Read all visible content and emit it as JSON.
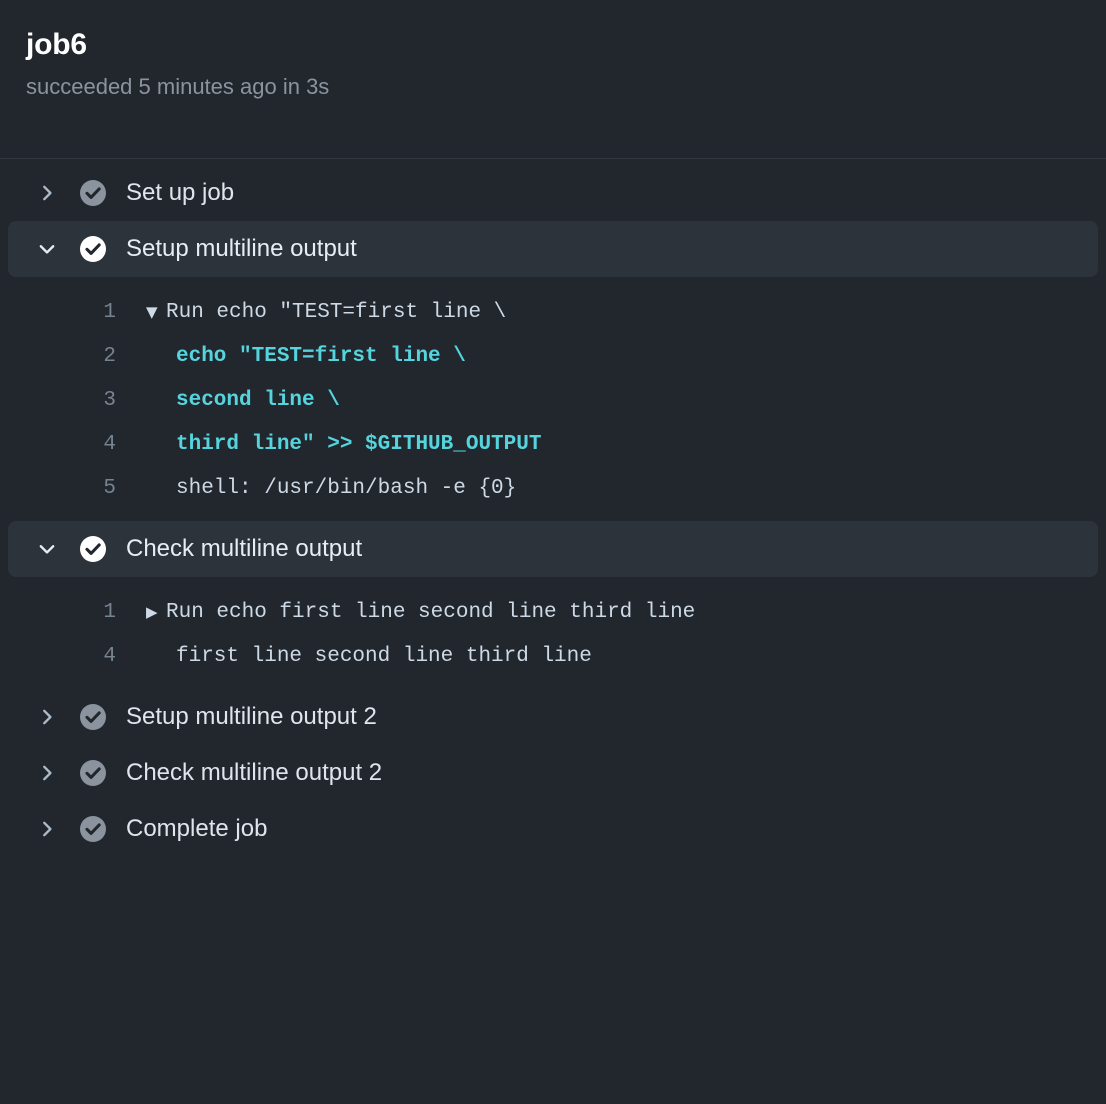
{
  "header": {
    "title": "job6",
    "status_line": "succeeded 5 minutes ago in 3s"
  },
  "colors": {
    "background": "#22272e",
    "row_highlight": "#2d333b",
    "accent_cyan": "#56d4dd",
    "text_primary": "#e6edf3",
    "text_muted": "#8b949e",
    "check_success": "#ffffff",
    "check_collapsed": "#8b939e"
  },
  "steps": [
    {
      "title": "Set up job",
      "state": "collapsed",
      "status": "success",
      "chevron_icon": "chevron-right-icon",
      "status_icon": "check-circle-icon",
      "log": []
    },
    {
      "title": "Setup multiline output",
      "state": "expanded",
      "status": "success",
      "chevron_icon": "chevron-down-icon",
      "status_icon": "check-circle-icon",
      "log": [
        {
          "num": "1",
          "marker": "▼",
          "indent": false,
          "text": "Run echo \"TEST=first line \\",
          "style": "plain"
        },
        {
          "num": "2",
          "marker": "",
          "indent": true,
          "text": "echo \"TEST=first line \\",
          "style": "cyan"
        },
        {
          "num": "3",
          "marker": "",
          "indent": true,
          "text": "second line \\",
          "style": "cyan"
        },
        {
          "num": "4",
          "marker": "",
          "indent": true,
          "text": "third line\" >> $GITHUB_OUTPUT",
          "style": "cyan"
        },
        {
          "num": "5",
          "marker": "",
          "indent": true,
          "text": "shell: /usr/bin/bash -e {0}",
          "style": "plain"
        }
      ]
    },
    {
      "title": "Check multiline output",
      "state": "expanded",
      "status": "success",
      "chevron_icon": "chevron-down-icon",
      "status_icon": "check-circle-icon",
      "log": [
        {
          "num": "1",
          "marker": "▶",
          "indent": false,
          "text": "Run echo first line second line third line",
          "style": "plain"
        },
        {
          "num": "4",
          "marker": "",
          "indent": true,
          "text": "first line second line third line",
          "style": "plain"
        }
      ]
    },
    {
      "title": "Setup multiline output 2",
      "state": "collapsed",
      "status": "success",
      "chevron_icon": "chevron-right-icon",
      "status_icon": "check-circle-icon",
      "log": []
    },
    {
      "title": "Check multiline output 2",
      "state": "collapsed",
      "status": "success",
      "chevron_icon": "chevron-right-icon",
      "status_icon": "check-circle-icon",
      "log": []
    },
    {
      "title": "Complete job",
      "state": "collapsed",
      "status": "success",
      "chevron_icon": "chevron-right-icon",
      "status_icon": "check-circle-icon",
      "log": []
    }
  ]
}
